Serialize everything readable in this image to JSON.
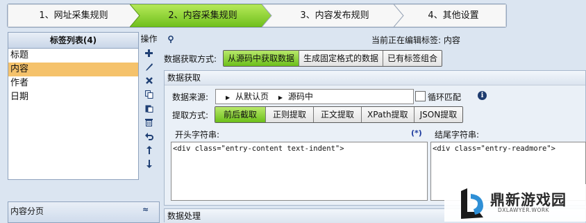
{
  "wizard": {
    "steps": [
      {
        "label": "1、网址采集规则",
        "active": false
      },
      {
        "label": "2、内容采集规则",
        "active": true
      },
      {
        "label": "3、内容发布规则",
        "active": false
      },
      {
        "label": "4、其他设置",
        "active": false
      }
    ]
  },
  "tag_list": {
    "title": "标签列表(4)",
    "items": [
      "标题",
      "内容",
      "作者",
      "日期"
    ],
    "selected": "内容"
  },
  "operations": {
    "title": "操作",
    "icons": [
      "add-icon",
      "edit-icon",
      "delete-icon",
      "copy-icon",
      "paste-icon",
      "trash-icon",
      "undo-icon",
      "move-up-icon",
      "move-down-icon"
    ]
  },
  "content_paging": {
    "title": "内容分页",
    "collapse_glyph": "≈"
  },
  "editing_status": "当前正在编辑标签: 内容",
  "fetch_mode": {
    "label": "数据获取方式:",
    "options": [
      "从源码中获取数据",
      "生成固定格式的数据",
      "已有标签组合"
    ],
    "selected": "从源码中获取数据"
  },
  "data_fetch": {
    "title": "数据获取",
    "source_label": "数据来源:",
    "source_path": [
      "从默认页",
      "源码中"
    ],
    "loop_match_label": "循环匹配",
    "loop_match_checked": false,
    "extract_label": "提取方式:",
    "extract_options": [
      "前后截取",
      "正则提取",
      "正文提取",
      "XPath提取",
      "JSON提取"
    ],
    "extract_selected": "前后截取",
    "start_label": "开头字符串:",
    "start_marker": "(*)",
    "start_value": "<div class=\"entry-content text-indent\">",
    "end_label": "结尾字符串:",
    "end_value": "<div class=\"entry-readmore\">"
  },
  "data_process": {
    "title": "数据处理"
  },
  "watermark": {
    "name": "鼎新游戏园",
    "domain": "DXLAWYER.WORK"
  },
  "colors": {
    "active_step": "#8fd42c",
    "selected_tab": "#6cc01a",
    "selected_row": "#f5c26b"
  }
}
